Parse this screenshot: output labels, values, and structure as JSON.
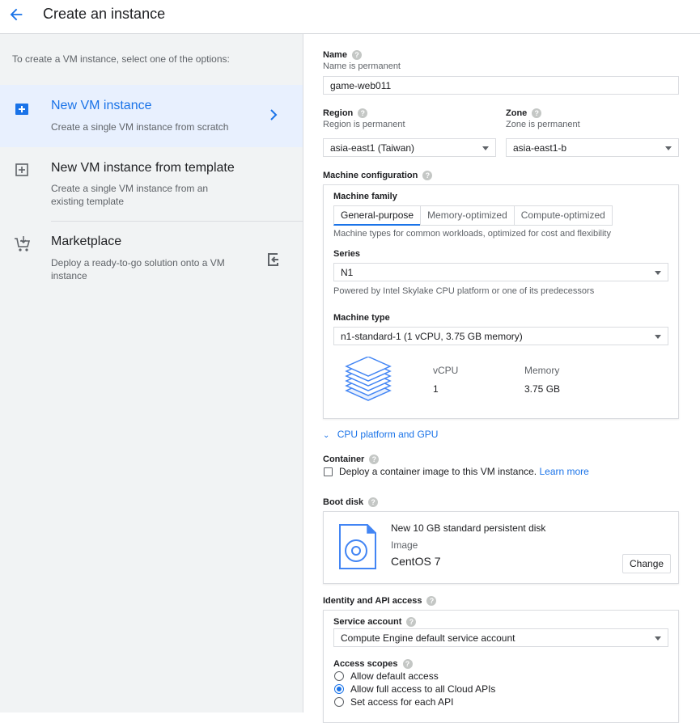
{
  "header": {
    "title": "Create an instance"
  },
  "left": {
    "intro": "To create a VM instance, select one of the options:",
    "options": [
      {
        "title": "New VM instance",
        "desc": "Create a single VM instance from scratch"
      },
      {
        "title": "New VM instance from template",
        "desc": "Create a single VM instance from an existing template"
      },
      {
        "title": "Marketplace",
        "desc": "Deploy a ready-to-go solution onto a VM instance"
      }
    ]
  },
  "form": {
    "name": {
      "label": "Name",
      "sub": "Name is permanent",
      "value": "game-web011"
    },
    "region": {
      "label": "Region",
      "sub": "Region is permanent",
      "value": "asia-east1 (Taiwan)"
    },
    "zone": {
      "label": "Zone",
      "sub": "Zone is permanent",
      "value": "asia-east1-b"
    },
    "machine": {
      "label": "Machine configuration",
      "family_label": "Machine family",
      "tabs": [
        "General-purpose",
        "Memory-optimized",
        "Compute-optimized"
      ],
      "family_desc": "Machine types for common workloads, optimized for cost and flexibility",
      "series_label": "Series",
      "series_value": "N1",
      "series_desc": "Powered by Intel Skylake CPU platform or one of its predecessors",
      "type_label": "Machine type",
      "type_value": "n1-standard-1 (1 vCPU, 3.75 GB memory)",
      "vcpu_label": "vCPU",
      "vcpu_value": "1",
      "memory_label": "Memory",
      "memory_value": "3.75 GB"
    },
    "cpu_gpu_link": "CPU platform and GPU",
    "container": {
      "label": "Container",
      "checkbox_text": "Deploy a container image to this VM instance.",
      "learn_more": "Learn more"
    },
    "boot": {
      "label": "Boot disk",
      "disk": "New 10 GB standard persistent disk",
      "image_label": "Image",
      "image_value": "CentOS 7",
      "change": "Change"
    },
    "identity": {
      "label": "Identity and API access",
      "service_label": "Service account",
      "service_value": "Compute Engine default service account",
      "scopes_label": "Access scopes",
      "scopes": [
        "Allow default access",
        "Allow full access to all Cloud APIs",
        "Set access for each API"
      ],
      "selected_scope": 1
    }
  },
  "colors": {
    "accent": "#1a73e8",
    "selected_bg": "#e8f0fe",
    "left_bg": "#f1f3f4"
  }
}
